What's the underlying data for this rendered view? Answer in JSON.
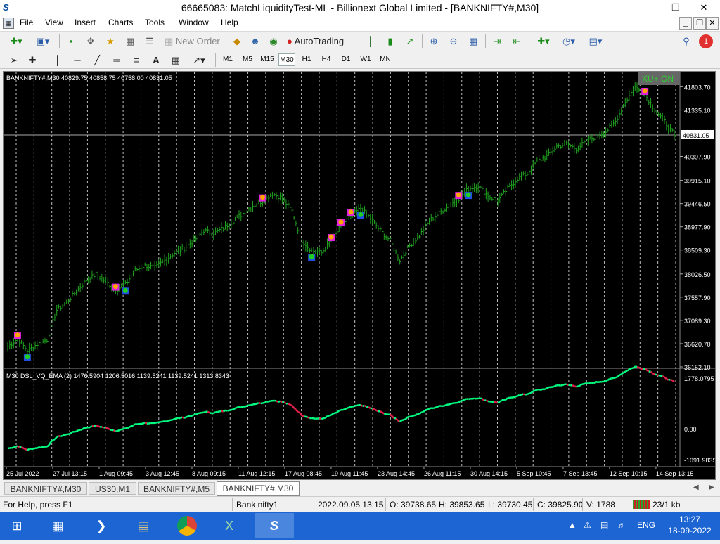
{
  "window": {
    "title": "66665083: MatchLiquidityTest-ML - Billionext Global Limited - [BANKNIFTY#,M30]",
    "app_icon": "mt4-logo-icon",
    "controls": [
      "minimize-icon",
      "restore-icon",
      "close-icon"
    ]
  },
  "menu": {
    "items": [
      "File",
      "View",
      "Insert",
      "Charts",
      "Tools",
      "Window",
      "Help"
    ]
  },
  "toolbar": {
    "new_order_label": "New Order",
    "autotrading_label": "AutoTrading",
    "timeframes": [
      "M1",
      "M5",
      "M15",
      "M30",
      "H1",
      "H4",
      "D1",
      "W1",
      "MN"
    ],
    "active_timeframe": "M30",
    "notification_count": "1"
  },
  "chart": {
    "symbol_info": "BANKNIFTY#,M30  40829.75 40858.75 40758.00 40831.05",
    "badge": "XU+ ON",
    "current_price": "40831.05",
    "price_ticks": [
      "41803.70",
      "41335.10",
      "40397.90",
      "39915.10",
      "39446.50",
      "38977.90",
      "38509.30",
      "38026.50",
      "37557.90",
      "37089.30",
      "36620.70",
      "36152.10"
    ],
    "indicator_label": "M30 DSL_VQ_EMA (2)  1476.5904 1206.5016 1139.5241 1139.5241 1313.8343",
    "indicator_ticks": [
      "1778.0795",
      "0.00",
      "-1091.9835"
    ],
    "time_ticks": [
      "25 Jul 2022",
      "27 Jul 13:15",
      "1 Aug 09:45",
      "3 Aug 12:45",
      "8 Aug 09:15",
      "11 Aug 12:15",
      "17 Aug 08:45",
      "19 Aug 11:45",
      "23 Aug 14:45",
      "26 Aug 11:15",
      "30 Aug 14:15",
      "5 Sep 10:45",
      "7 Sep 13:45",
      "12 Sep 10:15",
      "14 Sep 13:15"
    ],
    "colors": {
      "background": "#000000",
      "bars": "#1fa31f",
      "up_line": "#00ff80",
      "down_line": "#e0204a",
      "grid": "#ffffff",
      "text": "#ffffff"
    }
  },
  "chart_data": {
    "type": "line",
    "title": "",
    "xlabel": "",
    "ylabel": "",
    "ylim": [
      36152.1,
      42050
    ],
    "series": [
      {
        "name": "",
        "values": [
          36560,
          36720,
          36480,
          36610,
          36700,
          37300,
          37450,
          37680,
          37900,
          38020,
          37880,
          37700,
          37820,
          38100,
          38200,
          38150,
          38300,
          38450,
          38550,
          38700,
          38900,
          38850,
          38950,
          39100,
          39250,
          39400,
          39500,
          39650,
          39550,
          39300,
          38700,
          38500,
          38450,
          38700,
          39000,
          39200,
          39350,
          39150,
          38900,
          38700,
          38300,
          38600,
          38800,
          39100,
          39250,
          39400,
          39550,
          39750,
          39800,
          39600,
          39500,
          39750,
          39950,
          40050,
          40300,
          40400,
          40600,
          40650,
          40550,
          40700,
          40800,
          40900,
          41100,
          41500,
          41800,
          41650,
          41350,
          41100,
          40831
        ]
      }
    ]
  },
  "tabs": {
    "items": [
      "BANKNIFTY#,M30",
      "US30,M1",
      "BANKNIFTY#,M5",
      "BANKNIFTY#,M30"
    ],
    "active_index": 3
  },
  "status": {
    "help": "For Help, press F1",
    "profile": "Bank nifty1",
    "datetime": "2022.09.05 13:15",
    "open": "O: 39738.65",
    "high": "H: 39853.65",
    "low": "L: 39730.45",
    "close": "C: 39825.90",
    "volume": "V: 1788",
    "traffic": "23/1 kb"
  },
  "taskbar": {
    "apps": [
      "start-icon",
      "server-manager-icon",
      "powershell-icon",
      "file-explorer-icon",
      "chrome-icon",
      "excel-icon",
      "mt4-icon"
    ],
    "language": "ENG",
    "time": "13:27",
    "date": "18-09-2022"
  }
}
